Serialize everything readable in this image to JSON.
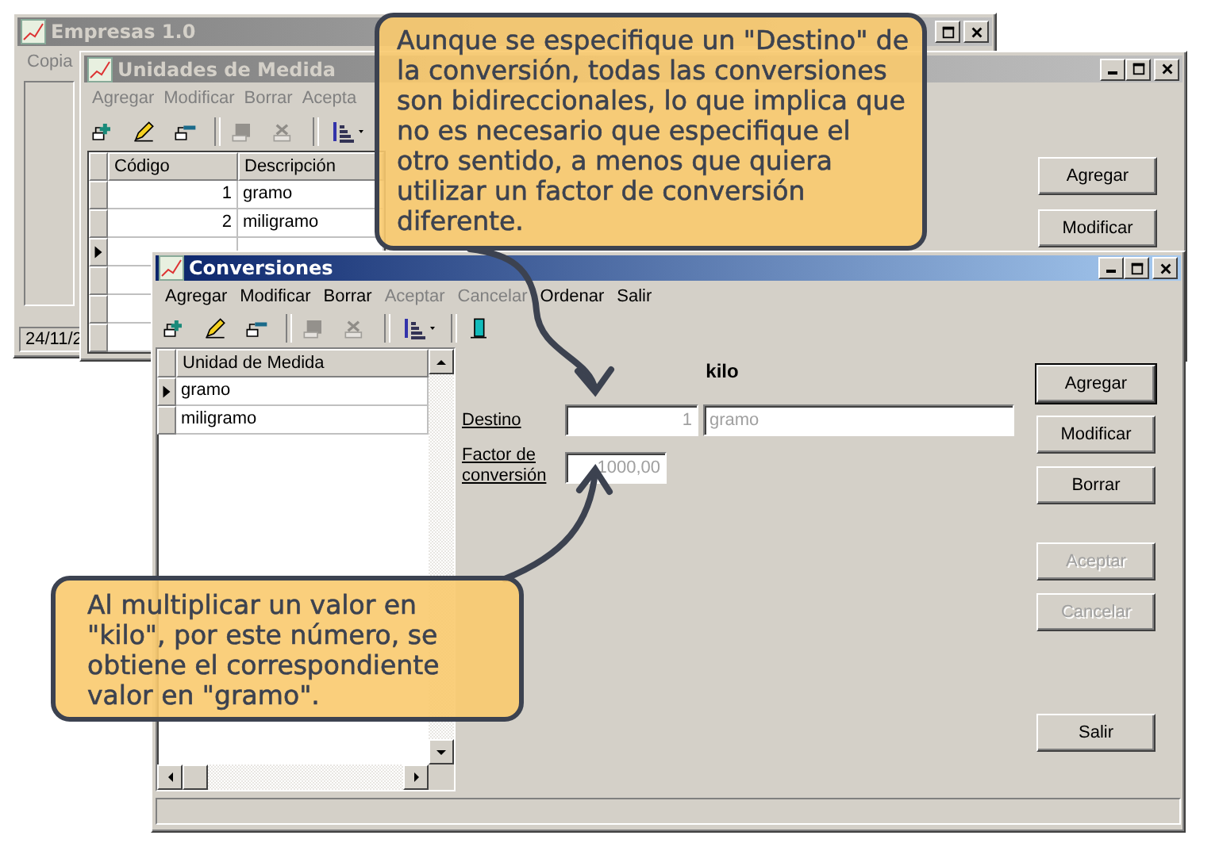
{
  "empresas_window": {
    "title": "Empresas 1.0",
    "menu": [
      "Copia"
    ],
    "status": "24/11/2"
  },
  "unidades_window": {
    "title": "Unidades de Medida",
    "menu": [
      {
        "label": "Agregar",
        "disabled": true
      },
      {
        "label": "Modificar",
        "disabled": true
      },
      {
        "label": "Borrar",
        "disabled": true
      },
      {
        "label": "Acepta",
        "disabled": true
      }
    ],
    "toolbar": [
      {
        "kind": "add",
        "disabled": false
      },
      {
        "kind": "edit",
        "disabled": false
      },
      {
        "kind": "remove",
        "disabled": false
      },
      {
        "kind": "separator"
      },
      {
        "kind": "save",
        "disabled": true
      },
      {
        "kind": "cancel",
        "disabled": true
      },
      {
        "kind": "separator"
      },
      {
        "kind": "sort",
        "disabled": false
      }
    ],
    "columns": [
      "Código",
      "Descripción"
    ],
    "rows": [
      {
        "cells": [
          "1",
          "gramo"
        ],
        "current": false
      },
      {
        "cells": [
          "2",
          "miligramo"
        ],
        "current": false
      },
      {
        "current": true
      }
    ],
    "buttons": [
      "Agregar",
      "Modificar"
    ]
  },
  "conversiones_window": {
    "title": "Conversiones",
    "menu": [
      {
        "label": "Agregar",
        "disabled": false
      },
      {
        "label": "Modificar",
        "disabled": false
      },
      {
        "label": "Borrar",
        "disabled": false
      },
      {
        "label": "Aceptar",
        "disabled": true
      },
      {
        "label": "Cancelar",
        "disabled": true
      },
      {
        "label": "Ordenar",
        "disabled": false
      },
      {
        "label": "Salir",
        "disabled": false
      }
    ],
    "toolbar": [
      {
        "kind": "add",
        "disabled": false
      },
      {
        "kind": "edit",
        "disabled": false
      },
      {
        "kind": "remove",
        "disabled": false
      },
      {
        "kind": "separator"
      },
      {
        "kind": "save",
        "disabled": true
      },
      {
        "kind": "cancel",
        "disabled": true
      },
      {
        "kind": "separator"
      },
      {
        "kind": "sort",
        "disabled": false
      },
      {
        "kind": "separator"
      },
      {
        "kind": "exit",
        "disabled": false
      }
    ],
    "list": {
      "column": "Unidad de Medida",
      "rows": [
        {
          "label": "gramo",
          "selected": true
        },
        {
          "label": "miligramo",
          "selected": false
        }
      ]
    },
    "unit": "kilo",
    "destino": {
      "label": "Destino",
      "value": "1",
      "unit": "gramo"
    },
    "factor": {
      "label": "Factor de conversión",
      "value": "1000,00"
    },
    "buttons": [
      {
        "label": "Agregar",
        "disabled": false,
        "default": true
      },
      {
        "label": "Modificar",
        "disabled": false,
        "default": false
      },
      {
        "label": "Borrar",
        "disabled": false,
        "default": false
      },
      {
        "label": "Aceptar",
        "disabled": true,
        "default": false
      },
      {
        "label": "Cancelar",
        "disabled": true,
        "default": false
      },
      {
        "label": "Salir",
        "disabled": false,
        "default": false
      }
    ]
  },
  "callouts": [
    {
      "text": "Aunque se especifique un \"Destino\" de la conversión, todas las conversiones son bidireccionales, lo que implica que no es necesario que especifique el otro sentido, a menos que quiera utilizar un factor de conversión diferente."
    },
    {
      "text": "Al multiplicar un valor en \"kilo\", por este número, se obtiene el correspondiente valor en \"gramo\"."
    }
  ]
}
